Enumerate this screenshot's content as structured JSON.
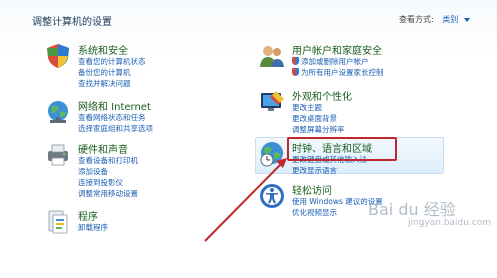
{
  "header": {
    "title": "调整计算机的设置",
    "view_by_label": "查看方式:",
    "view_by_value": "类别"
  },
  "left": [
    {
      "title": "系统和安全",
      "links": [
        "查看您的计算机状态",
        "备份您的计算机",
        "查找并解决问题"
      ]
    },
    {
      "title": "网络和 Internet",
      "links": [
        "查看网络状态和任务",
        "选择家庭组和共享选项"
      ]
    },
    {
      "title": "硬件和声音",
      "links": [
        "查看设备和打印机",
        "添加设备",
        "连接到投影仪",
        "调整常用移动设置"
      ]
    },
    {
      "title": "程序",
      "links": [
        "卸载程序"
      ]
    }
  ],
  "right": [
    {
      "title": "用户帐户和家庭安全",
      "links": [
        "添加或删除用户帐户",
        "为所有用户设置家长控制"
      ]
    },
    {
      "title": "外观和个性化",
      "links": [
        "更改主题",
        "更改桌面背景",
        "调整屏幕分辨率"
      ]
    },
    {
      "title": "时钟、语言和区域",
      "links": [
        "更改键盘或其他输入法",
        "更改显示语言"
      ]
    },
    {
      "title": "轻松访问",
      "links": [
        "使用 Windows 建议的设置",
        "优化视频显示"
      ]
    }
  ],
  "watermark": {
    "text": "Bai du 经验",
    "sub": "jingyan.baidu.com"
  },
  "colors": {
    "highlight": "#c0282c",
    "link": "#1a5fb4",
    "category": "#1a5f1e"
  }
}
